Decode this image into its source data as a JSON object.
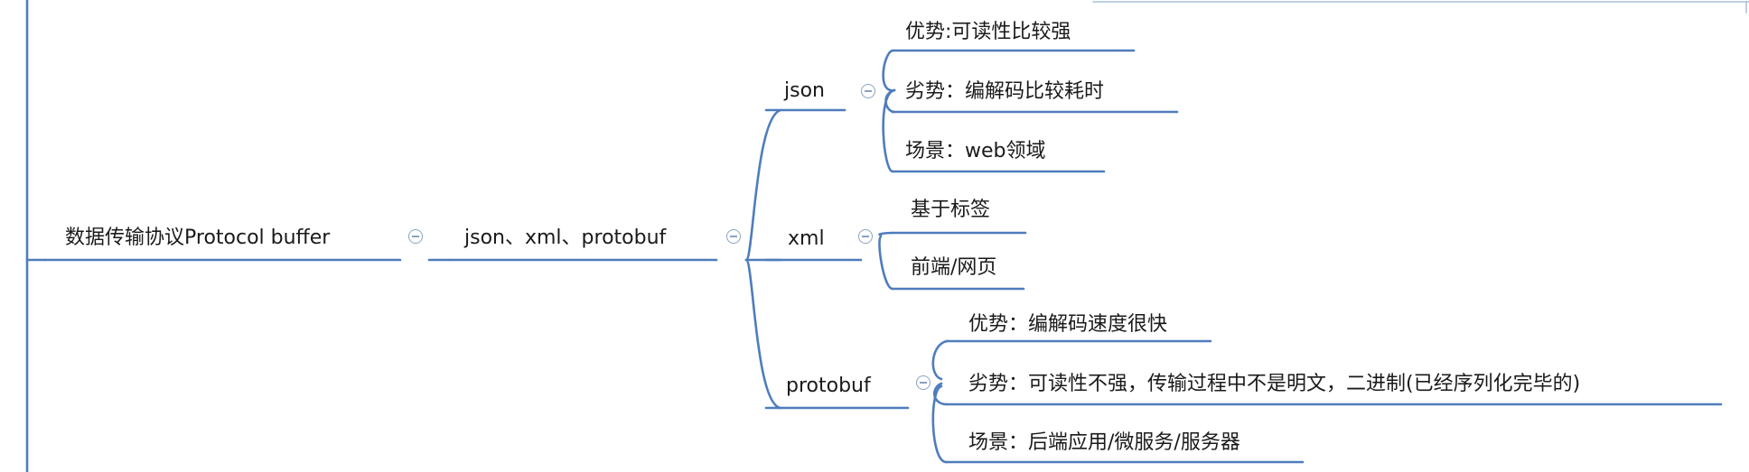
{
  "mindmap": {
    "root": {
      "label": "数据传输协议Protocol buffer"
    },
    "group": {
      "label": "json、xml、protobuf"
    },
    "branches": [
      {
        "label": "json",
        "items": [
          "优势:可读性比较强",
          "劣势：编解码比较耗时",
          "场景：web领域"
        ]
      },
      {
        "label": "xml",
        "items": [
          "基于标签",
          "前端/网页"
        ]
      },
      {
        "label": "protobuf",
        "items": [
          "优势：编解码速度很快",
          "劣势：可读性不强，传输过程中不是明文，二进制(已经序列化完毕的)",
          "场景：后端应用/微服务/服务器"
        ]
      }
    ],
    "toggle_icon": "collapse-minus-icon",
    "colors": {
      "line": "#4f7cbc",
      "toggle": "#8aa2c2",
      "text": "#1a1a1a",
      "background": "#ffffff"
    }
  }
}
